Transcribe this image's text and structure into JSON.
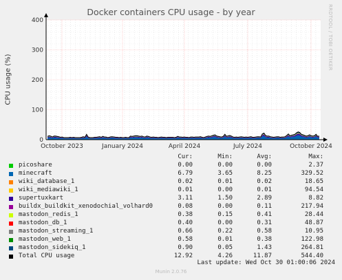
{
  "chart_data": {
    "type": "area",
    "title": "Docker containers CPU usage - by year",
    "ylabel": "CPU usage (%)",
    "ylim": [
      0,
      400
    ],
    "yticks": [
      "0",
      "100",
      "200",
      "300",
      "400"
    ],
    "xticks": [
      "October 2023",
      "January 2024",
      "April 2024",
      "July 2024",
      "October 2024"
    ],
    "grid": true,
    "total_profile": [
      11,
      13,
      12,
      9,
      12,
      12,
      11,
      10,
      8,
      9,
      7,
      7,
      7,
      7,
      8,
      7,
      8,
      7,
      7,
      7,
      7,
      8,
      10,
      8,
      18,
      9,
      7,
      7,
      7,
      8,
      8,
      9,
      10,
      8,
      11,
      9,
      9,
      7,
      8,
      10,
      10,
      9,
      8,
      8,
      7,
      8,
      7,
      7,
      8,
      7,
      7,
      12,
      11,
      12,
      13,
      13,
      12,
      11,
      12,
      10,
      9,
      12,
      11,
      9,
      8,
      9,
      8,
      8,
      7,
      8,
      9,
      8,
      8,
      7,
      8,
      8,
      8,
      8,
      7,
      8,
      11,
      9,
      9,
      8,
      9,
      8,
      8,
      7,
      9,
      9,
      8,
      9,
      9,
      9,
      10,
      8,
      7,
      9,
      11,
      12,
      11,
      13,
      15,
      16,
      12,
      11,
      10,
      9,
      11,
      18,
      11,
      13,
      14,
      12,
      9,
      8,
      9,
      8,
      9,
      10,
      9,
      8,
      9,
      8,
      9,
      10,
      8,
      8,
      9,
      10,
      10,
      9,
      19,
      22,
      14,
      12,
      12,
      10,
      9,
      8,
      9,
      10,
      10,
      8,
      9,
      9,
      10,
      14,
      19,
      13,
      15,
      16,
      18,
      23,
      26,
      24,
      18,
      16,
      14,
      12,
      13,
      16,
      13,
      12,
      13,
      18,
      11,
      12
    ],
    "legend_headers": {
      "cur": "Cur:",
      "min": "Min:",
      "avg": "Avg:",
      "max": "Max:"
    },
    "series": [
      {
        "name": "picoshare",
        "color": "#00cc00",
        "cur": "0.00",
        "min": "0.00",
        "avg": "0.00",
        "max": "2.37"
      },
      {
        "name": "minecraft",
        "color": "#0066b3",
        "cur": "6.79",
        "min": "3.65",
        "avg": "8.25",
        "max": "329.52"
      },
      {
        "name": "wiki_database_1",
        "color": "#ff8000",
        "cur": "0.02",
        "min": "0.01",
        "avg": "0.02",
        "max": "18.65"
      },
      {
        "name": "wiki_mediawiki_1",
        "color": "#ffcc00",
        "cur": "0.01",
        "min": "0.00",
        "avg": "0.01",
        "max": "94.54"
      },
      {
        "name": "supertuxkart",
        "color": "#330099",
        "cur": "3.11",
        "min": "1.50",
        "avg": "2.89",
        "max": "8.82"
      },
      {
        "name": "buildx_buildkit_xenodochial_volhard0",
        "color": "#990099",
        "cur": "0.08",
        "min": "0.00",
        "avg": "0.11",
        "max": "217.94"
      },
      {
        "name": "mastodon_redis_1",
        "color": "#ccff00",
        "cur": "0.38",
        "min": "0.15",
        "avg": "0.41",
        "max": "28.44"
      },
      {
        "name": "mastodon_db_1",
        "color": "#ff0000",
        "cur": "0.40",
        "min": "0.00",
        "avg": "0.31",
        "max": "48.87"
      },
      {
        "name": "mastodon_streaming_1",
        "color": "#808080",
        "cur": "0.66",
        "min": "0.22",
        "avg": "0.58",
        "max": "10.95"
      },
      {
        "name": "mastodon_web_1",
        "color": "#008f00",
        "cur": "0.58",
        "min": "0.01",
        "avg": "0.38",
        "max": "122.98"
      },
      {
        "name": "mastodon_sidekiq_1",
        "color": "#00487d",
        "cur": "0.90",
        "min": "0.05",
        "avg": "1.43",
        "max": "264.81"
      }
    ],
    "total": {
      "name": "Total CPU usage",
      "color": "#000000",
      "cur": "12.92",
      "min": "4.26",
      "avg": "11.87",
      "max": "544.40"
    },
    "last_update": "Last update: Wed Oct 30 01:00:06 2024",
    "side_text": "RRDTOOL / TOBI OETIKER",
    "footer": "Munin 2.0.76"
  }
}
